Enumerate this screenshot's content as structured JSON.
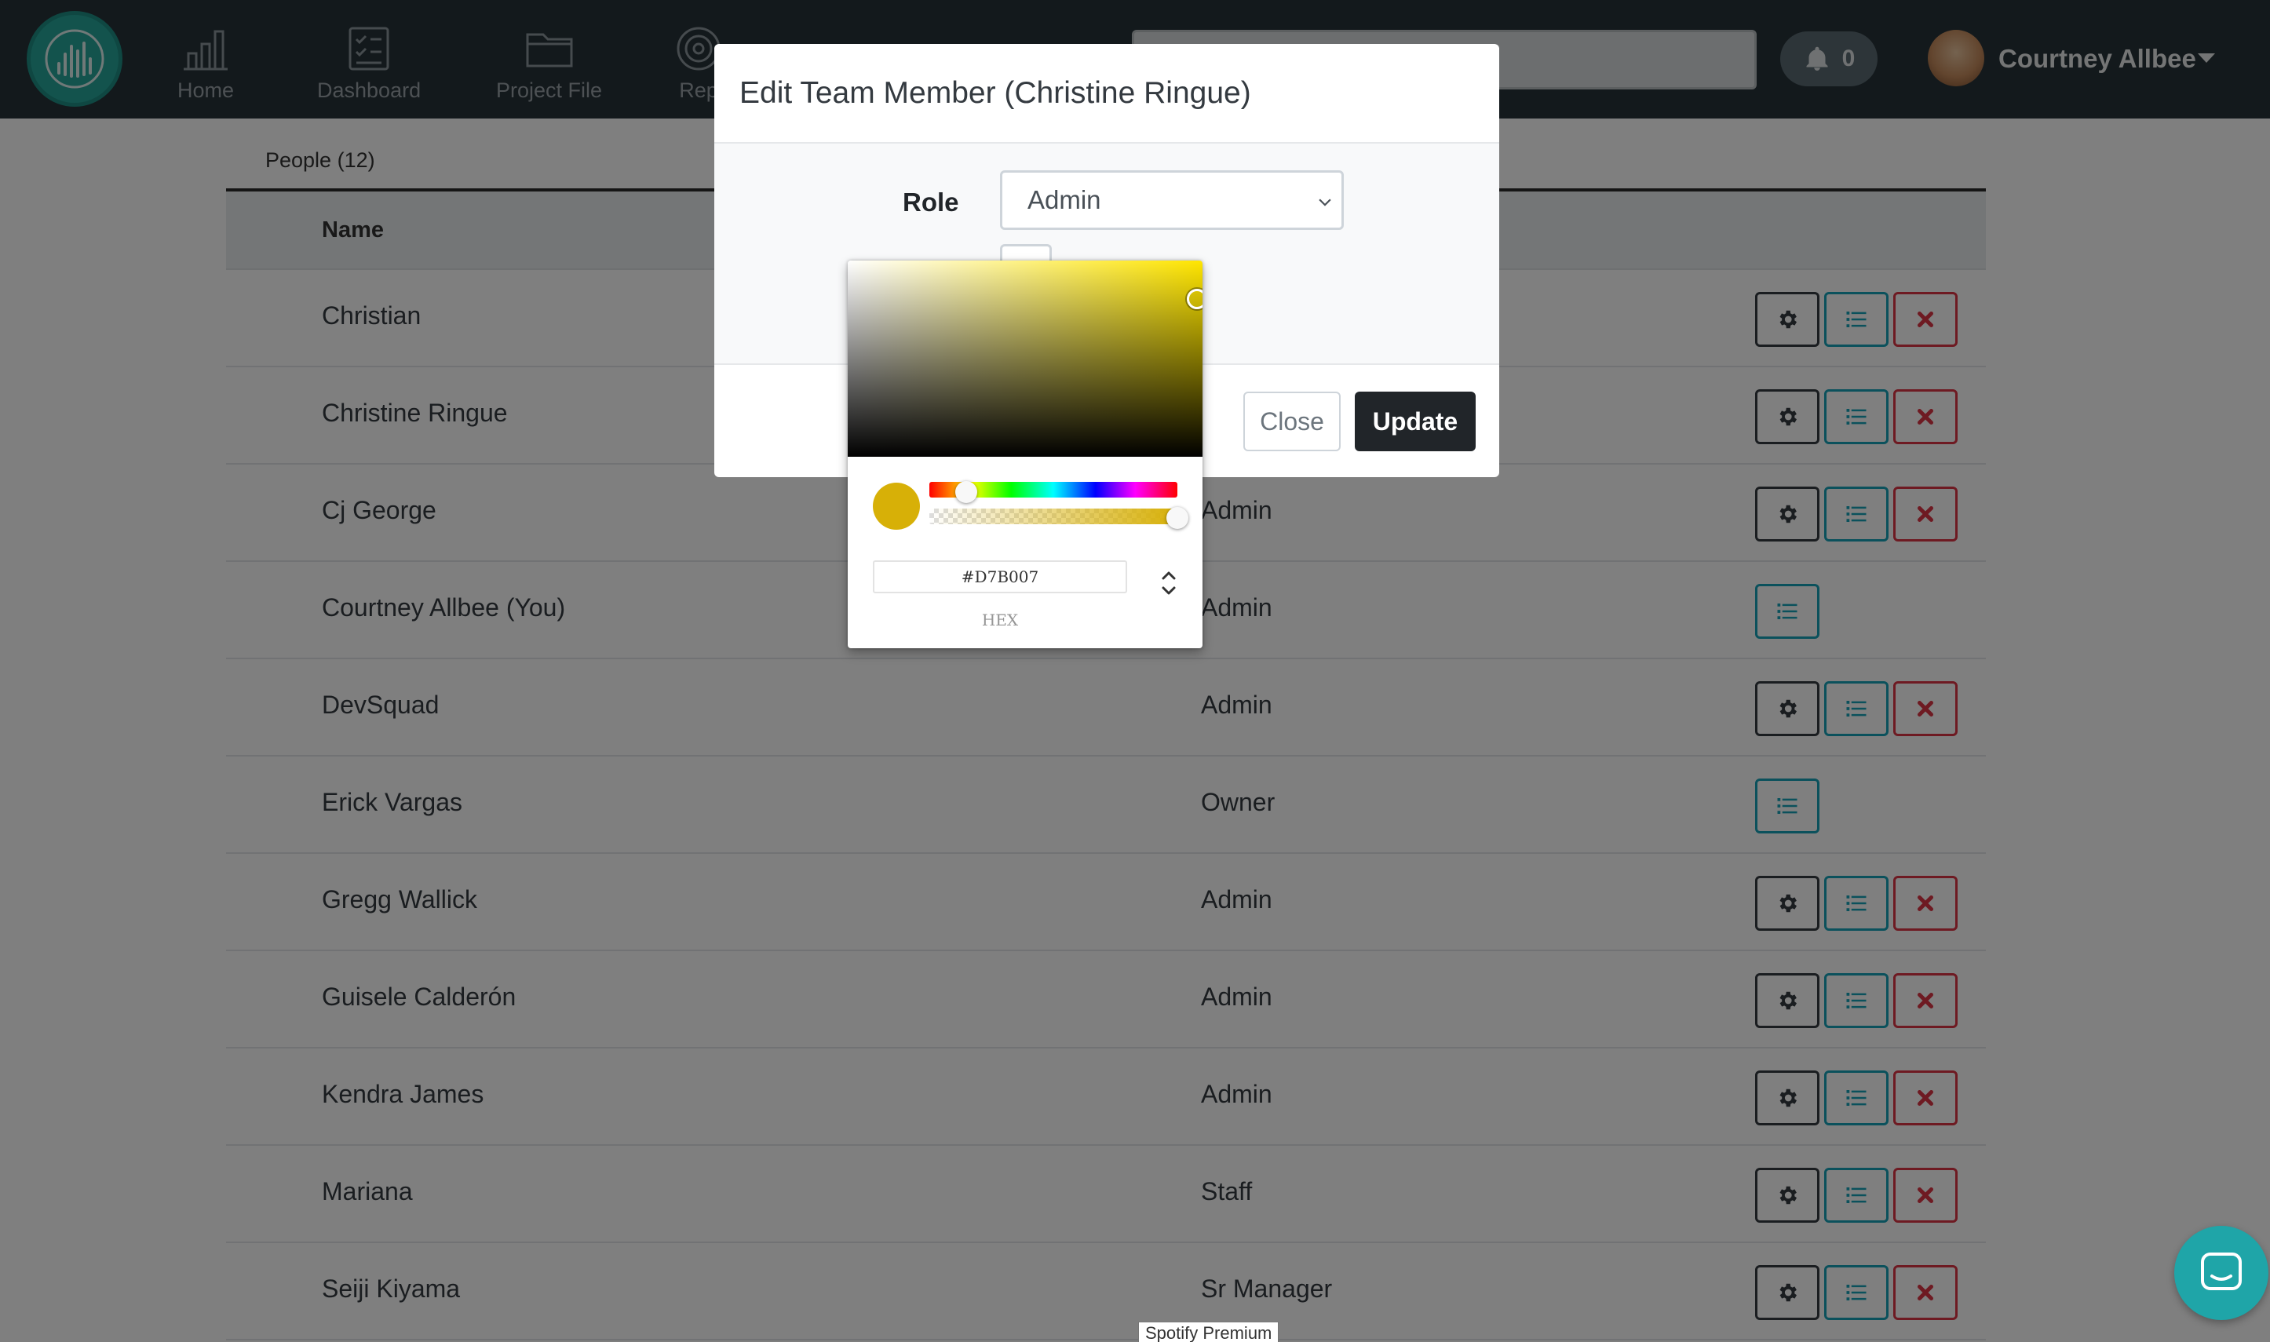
{
  "nav": {
    "items": [
      {
        "label": "Home",
        "icon": "bar-chart-icon"
      },
      {
        "label": "Dashboard",
        "icon": "checklist-icon"
      },
      {
        "label": "Project File",
        "icon": "folder-icon"
      },
      {
        "label": "Rep",
        "icon": "target-icon"
      }
    ],
    "notifications_count": "0",
    "user_name": "Courtney Allbee"
  },
  "people": {
    "tab_label": "People (12)",
    "columns": {
      "name": "Name"
    },
    "rows": [
      {
        "name": "Christian",
        "role": "",
        "actions": [
          "settings",
          "list",
          "delete"
        ]
      },
      {
        "name": "Christine Ringue",
        "role": "",
        "actions": [
          "settings",
          "list",
          "delete"
        ]
      },
      {
        "name": "Cj George",
        "role": "Admin",
        "actions": [
          "settings",
          "list",
          "delete"
        ]
      },
      {
        "name": "Courtney Allbee (You)",
        "role": "Admin",
        "actions": [
          "list"
        ]
      },
      {
        "name": "DevSquad",
        "role": "Admin",
        "actions": [
          "settings",
          "list",
          "delete"
        ]
      },
      {
        "name": "Erick Vargas",
        "role": "Owner",
        "actions": [
          "list"
        ]
      },
      {
        "name": "Gregg Wallick",
        "role": "Admin",
        "actions": [
          "settings",
          "list",
          "delete"
        ]
      },
      {
        "name": "Guisele Calderón",
        "role": "Admin",
        "actions": [
          "settings",
          "list",
          "delete"
        ]
      },
      {
        "name": "Kendra James",
        "role": "Admin",
        "actions": [
          "settings",
          "list",
          "delete"
        ]
      },
      {
        "name": "Mariana",
        "role": "Staff",
        "actions": [
          "settings",
          "list",
          "delete"
        ]
      },
      {
        "name": "Seiji Kiyama",
        "role": "Sr Manager",
        "actions": [
          "settings",
          "list",
          "delete"
        ]
      }
    ]
  },
  "modal": {
    "title": "Edit Team Member (Christine Ringue)",
    "role_label": "Role",
    "role_value": "Admin",
    "close_label": "Close",
    "update_label": "Update"
  },
  "color_picker": {
    "hex_value": "#D7B007",
    "mode_label": "HEX",
    "hue_level": 0.15,
    "alpha_level": 1.0,
    "color": "#D7B007"
  },
  "tooltip": "Spotify Premium",
  "colors": {
    "navbar": "#263238",
    "accent_teal": "#26a69a",
    "info": "#17a2b8",
    "danger": "#dc3545",
    "dark": "#212529"
  }
}
